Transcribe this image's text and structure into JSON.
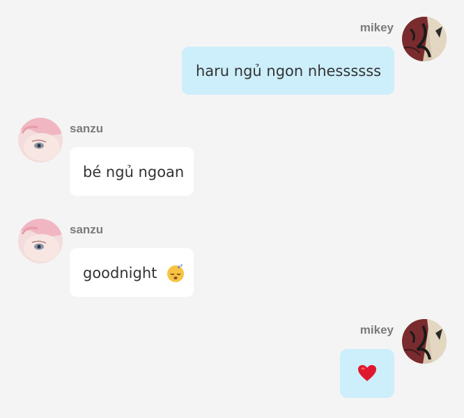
{
  "messages": [
    {
      "sender": "mikey",
      "text": "haru ngủ ngon nhessssss"
    },
    {
      "sender": "sanzu",
      "text": "bé ngủ ngoan"
    },
    {
      "sender": "sanzu",
      "text": "goodnight"
    },
    {
      "sender": "mikey",
      "text": ""
    }
  ],
  "icons": {
    "sleep_emoji": "sleeping-face-icon",
    "heart_emoji": "red-heart-icon"
  },
  "colors": {
    "background": "#f4f4f4",
    "mine_bubble": "#cdeefb",
    "theirs_bubble": "#ffffff",
    "name_text": "#7a7a7a",
    "heart": "#e0182d"
  }
}
